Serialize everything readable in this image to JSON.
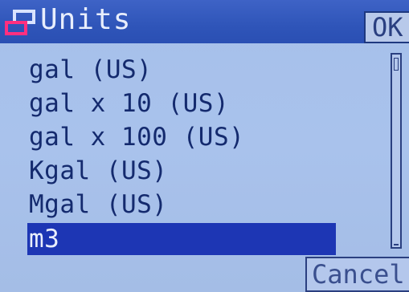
{
  "dialog": {
    "title": "Units",
    "icon": "windows-icon",
    "ok_label": "OK",
    "cancel_label": "Cancel"
  },
  "units": {
    "items": [
      {
        "label": "gal (US)"
      },
      {
        "label": "gal x 10 (US)"
      },
      {
        "label": "gal x 100 (US)"
      },
      {
        "label": "Kgal (US)"
      },
      {
        "label": "Mgal (US)"
      },
      {
        "label": "m3"
      }
    ],
    "selected_index": 5
  },
  "colors": {
    "titlebar": "#2f55b9",
    "selection": "#1d36b4",
    "background": "#a9c2ec",
    "text": "#142a6e"
  }
}
